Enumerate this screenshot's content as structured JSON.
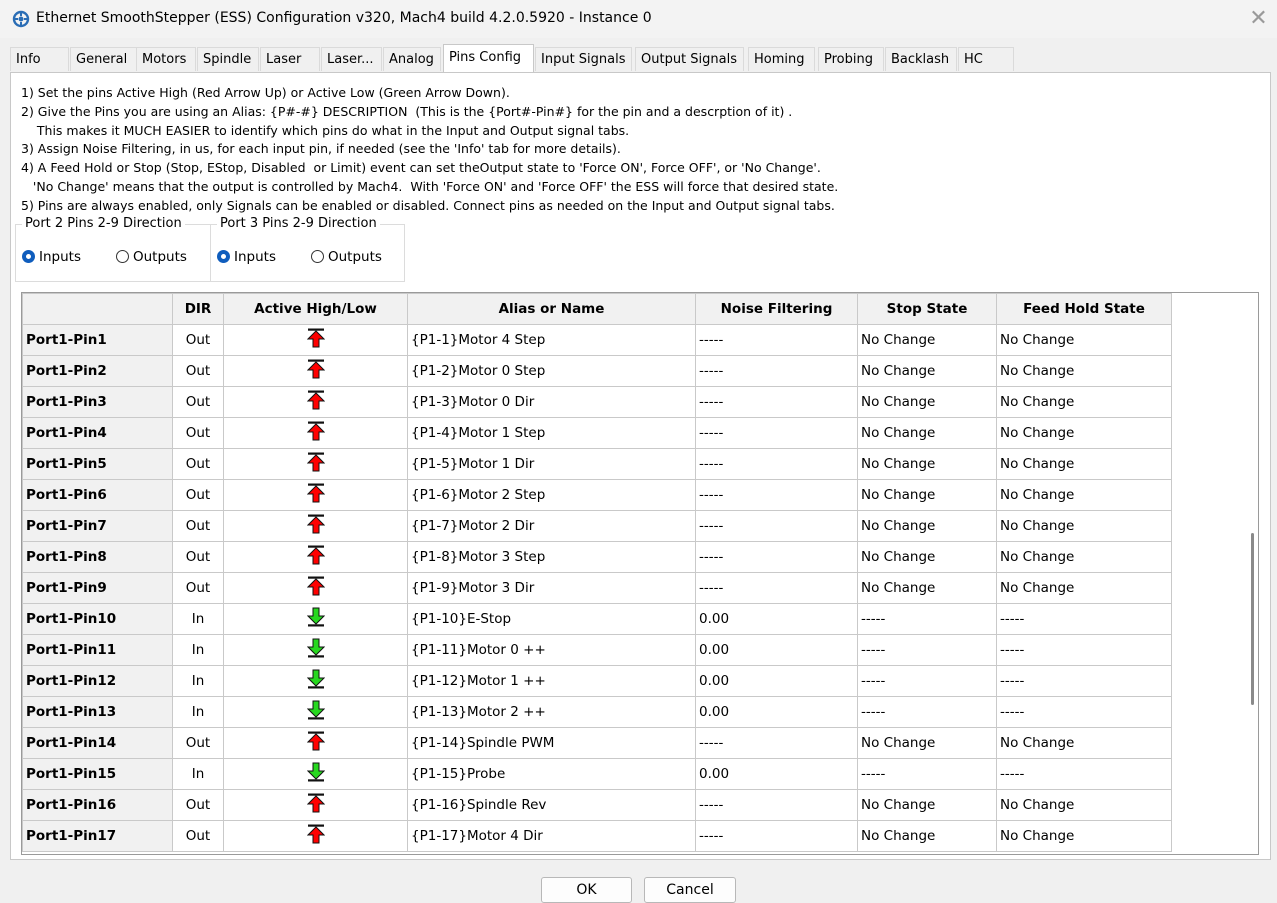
{
  "window": {
    "title": "Ethernet SmoothStepper (ESS) Configuration v320, Mach4 build 4.2.0.5920 - Instance 0"
  },
  "tabs": [
    "Info",
    "General",
    "Motors",
    "Spindle",
    "Laser",
    "Laser...",
    "Analog",
    "Pins Config",
    "Input Signals",
    "Output Signals",
    "Homing",
    "Probing",
    "Backlash",
    "HC"
  ],
  "active_tab": "Pins Config",
  "instructions": [
    "1) Set the pins Active High (Red Arrow Up) or Active Low (Green Arrow Down).",
    "2) Give the Pins you are using an Alias: {P#-#} DESCRIPTION  (This is the {Port#-Pin#} for the pin and a descrption of it) .",
    "    This makes it MUCH EASIER to identify which pins do what in the Input and Output signal tabs.",
    "3) Assign Noise Filtering, in us, for each input pin, if needed (see the 'Info' tab for more details).",
    "4) A Feed Hold or Stop (Stop, EStop, Disabled  or Limit) event can set theOutput state to 'Force ON', Force OFF', or 'No Change'.",
    "   'No Change' means that the output is controlled by Mach4.  With 'Force ON' and 'Force OFF' the ESS will force that desired state.",
    "5) Pins are always enabled, only Signals can be enabled or disabled. Connect pins as needed on the Input and Output signal tabs."
  ],
  "direction_groups": [
    {
      "title": "Port 2 Pins 2-9 Direction",
      "inputs_label": "Inputs",
      "outputs_label": "Outputs",
      "selected": "Inputs"
    },
    {
      "title": "Port 3 Pins 2-9 Direction",
      "inputs_label": "Inputs",
      "outputs_label": "Outputs",
      "selected": "Inputs"
    }
  ],
  "grid": {
    "columns": [
      "",
      "DIR",
      "Active High/Low",
      "Alias or Name",
      "Noise Filtering",
      "Stop State",
      "Feed Hold State"
    ],
    "rows": [
      {
        "name": "Port1-Pin1",
        "dir": "Out",
        "active": "high",
        "alias": "{P1-1}Motor 4 Step",
        "noise": "-----",
        "stop": "No Change",
        "hold": "No Change"
      },
      {
        "name": "Port1-Pin2",
        "dir": "Out",
        "active": "high",
        "alias": "{P1-2}Motor 0 Step",
        "noise": "-----",
        "stop": "No Change",
        "hold": "No Change"
      },
      {
        "name": "Port1-Pin3",
        "dir": "Out",
        "active": "high",
        "alias": "{P1-3}Motor 0 Dir",
        "noise": "-----",
        "stop": "No Change",
        "hold": "No Change"
      },
      {
        "name": "Port1-Pin4",
        "dir": "Out",
        "active": "high",
        "alias": "{P1-4}Motor 1 Step",
        "noise": "-----",
        "stop": "No Change",
        "hold": "No Change"
      },
      {
        "name": "Port1-Pin5",
        "dir": "Out",
        "active": "high",
        "alias": "{P1-5}Motor 1 Dir",
        "noise": "-----",
        "stop": "No Change",
        "hold": "No Change"
      },
      {
        "name": "Port1-Pin6",
        "dir": "Out",
        "active": "high",
        "alias": "{P1-6}Motor 2 Step",
        "noise": "-----",
        "stop": "No Change",
        "hold": "No Change"
      },
      {
        "name": "Port1-Pin7",
        "dir": "Out",
        "active": "high",
        "alias": "{P1-7}Motor 2 Dir",
        "noise": "-----",
        "stop": "No Change",
        "hold": "No Change"
      },
      {
        "name": "Port1-Pin8",
        "dir": "Out",
        "active": "high",
        "alias": "{P1-8}Motor 3 Step",
        "noise": "-----",
        "stop": "No Change",
        "hold": "No Change"
      },
      {
        "name": "Port1-Pin9",
        "dir": "Out",
        "active": "high",
        "alias": "{P1-9}Motor 3 Dir",
        "noise": "-----",
        "stop": "No Change",
        "hold": "No Change"
      },
      {
        "name": "Port1-Pin10",
        "dir": "In",
        "active": "low",
        "alias": "{P1-10}E-Stop",
        "noise": "0.00",
        "stop": "-----",
        "hold": "-----"
      },
      {
        "name": "Port1-Pin11",
        "dir": "In",
        "active": "low",
        "alias": "{P1-11}Motor 0 ++",
        "noise": "0.00",
        "stop": "-----",
        "hold": "-----"
      },
      {
        "name": "Port1-Pin12",
        "dir": "In",
        "active": "low",
        "alias": "{P1-12}Motor 1 ++",
        "noise": "0.00",
        "stop": "-----",
        "hold": "-----"
      },
      {
        "name": "Port1-Pin13",
        "dir": "In",
        "active": "low",
        "alias": "{P1-13}Motor 2 ++",
        "noise": "0.00",
        "stop": "-----",
        "hold": "-----"
      },
      {
        "name": "Port1-Pin14",
        "dir": "Out",
        "active": "high",
        "alias": "{P1-14}Spindle PWM",
        "noise": "-----",
        "stop": "No Change",
        "hold": "No Change"
      },
      {
        "name": "Port1-Pin15",
        "dir": "In",
        "active": "low",
        "alias": "{P1-15}Probe",
        "noise": "0.00",
        "stop": "-----",
        "hold": "-----"
      },
      {
        "name": "Port1-Pin16",
        "dir": "Out",
        "active": "high",
        "alias": "{P1-16}Spindle Rev",
        "noise": "-----",
        "stop": "No Change",
        "hold": "No Change"
      },
      {
        "name": "Port1-Pin17",
        "dir": "Out",
        "active": "high",
        "alias": "{P1-17}Motor 4 Dir",
        "noise": "-----",
        "stop": "No Change",
        "hold": "No Change"
      }
    ]
  },
  "buttons": {
    "ok": "OK",
    "cancel": "Cancel"
  },
  "icons": {
    "active_high": "red-arrow-up-icon",
    "active_low": "green-arrow-down-icon"
  },
  "colors": {
    "active_high": "#ff0000",
    "active_low": "#27d81f",
    "radio_selected": "#0f5dbd"
  }
}
